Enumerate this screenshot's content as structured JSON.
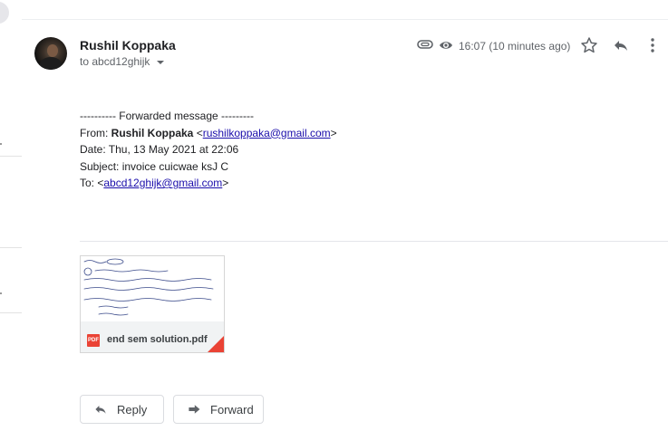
{
  "message": {
    "sender_name": "Rushil Koppaka",
    "to_label": "to abcd12ghijk",
    "timestamp": "16:07 (10 minutes ago)"
  },
  "body": {
    "forward_header": "---------- Forwarded message ---------",
    "from_prefix": "From: ",
    "from_name": "Rushil Koppaka",
    "from_email_open": " <",
    "from_email": "rushilkoppaka@gmail.com",
    "from_email_close": ">",
    "date_line": "Date: Thu, 13 May 2021 at 22:06",
    "subject_line": "Subject: invoice cuicwae ksJ C",
    "to_prefix": "To: <",
    "to_email": "abcd12ghijk@gmail.com",
    "to_email_close": ">"
  },
  "attachment": {
    "filename": "end sem solution.pdf",
    "badge": "PDF"
  },
  "actions": {
    "reply_label": "Reply",
    "forward_label": "Forward"
  },
  "icons": [
    "paperclip-icon",
    "eye-icon",
    "star-icon",
    "reply-icon",
    "more-vert-icon",
    "pdf-icon",
    "forward-icon"
  ],
  "colors": {
    "link": "#1a0dab",
    "pdf_red": "#ea4335",
    "text_secondary": "#5f6368"
  }
}
